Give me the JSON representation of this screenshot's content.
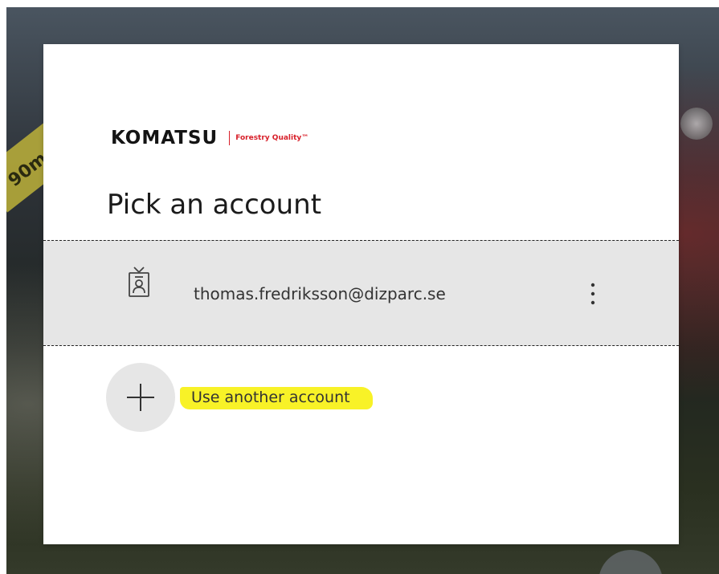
{
  "brand": {
    "name": "KOMATSU",
    "tagline": "Forestry Quality™",
    "accent_color": "#d8202a"
  },
  "background": {
    "sign_text": "90m"
  },
  "page": {
    "title": "Pick an account"
  },
  "accounts": [
    {
      "email": "thomas.fredriksson@dizparc.se",
      "icon": "badge-person-icon",
      "menu_icon": "more-vertical-icon"
    }
  ],
  "other_account": {
    "label": "Use another account",
    "icon": "plus-icon",
    "highlight_color": "#f8f227"
  }
}
